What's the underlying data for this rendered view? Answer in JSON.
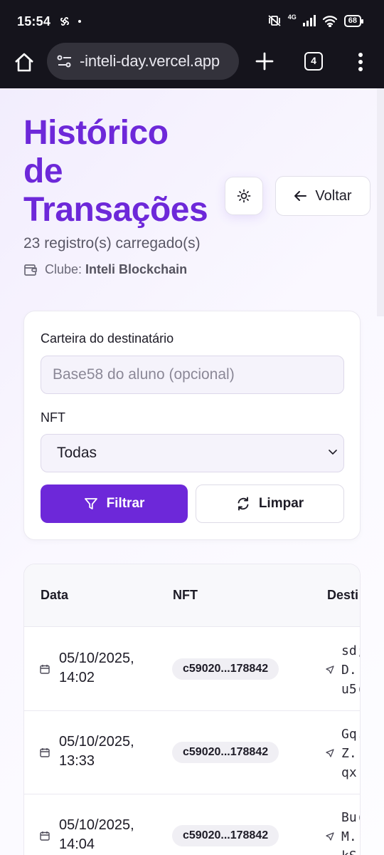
{
  "status_bar": {
    "time": "15:54",
    "network": "4G",
    "battery": "68",
    "icons": [
      "fan-icon",
      "dot-icon",
      "mute-vibrate-icon",
      "signal-icon",
      "wifi-icon",
      "battery-icon"
    ]
  },
  "browser": {
    "url": "-inteli-day.vercel.app",
    "tab_count": "4",
    "icons": [
      "home-icon",
      "site-settings-icon",
      "plus-icon",
      "tabs-icon",
      "menu-icon"
    ]
  },
  "header": {
    "title_lines": [
      "Histórico",
      "de",
      "Transações"
    ],
    "subtitle": "23 registro(s) carregado(s)",
    "club_label": "Clube:",
    "club_name": "Inteli Blockchain",
    "back_label": "Voltar"
  },
  "filters": {
    "wallet_label": "Carteira do destinatário",
    "wallet_placeholder": "Base58 do aluno (opcional)",
    "nft_label": "NFT",
    "nft_selected": "Todas",
    "filter_button": "Filtrar",
    "clear_button": "Limpar"
  },
  "table": {
    "columns": [
      "Data",
      "NFT",
      "Desti"
    ],
    "rows": [
      {
        "date_line1": "05/10/2025,",
        "date_line2": "14:02",
        "nft": "c59020...178842",
        "dest": "sd;\nD.\nu5("
      },
      {
        "date_line1": "05/10/2025,",
        "date_line2": "13:33",
        "nft": "c59020...178842",
        "dest": "Gq.\nZ.\nqx|"
      },
      {
        "date_line1": "05/10/2025,",
        "date_line2": "14:04",
        "nft": "c59020...178842",
        "dest": "Bu(\nM.\nkS."
      }
    ]
  },
  "colors": {
    "accent": "#6d28d9",
    "chrome": "#15141c",
    "url_pill": "#33323b"
  }
}
